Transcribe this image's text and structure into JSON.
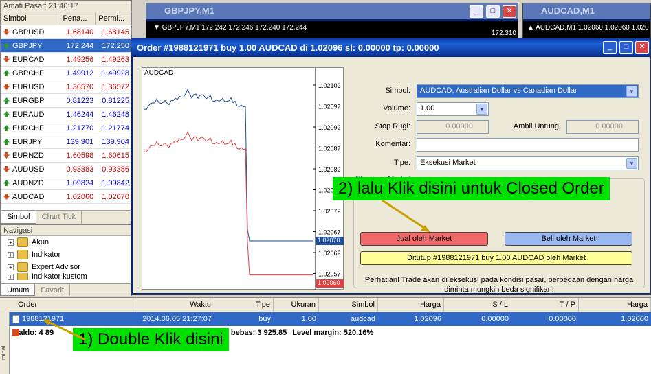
{
  "market_watch": {
    "title": "Amati Pasar: 21:40:17",
    "col_symbol": "Simbol",
    "col_bid": "Pena...",
    "col_ask": "Permi...",
    "rows": [
      {
        "symbol": "GBPUSD",
        "bid": "1.68140",
        "ask": "1.68145",
        "dir": "dn"
      },
      {
        "symbol": "GBPJPY",
        "bid": "172.244",
        "ask": "172.250",
        "dir": "up"
      },
      {
        "symbol": "EURCAD",
        "bid": "1.49256",
        "ask": "1.49263",
        "dir": "dn"
      },
      {
        "symbol": "GBPCHF",
        "bid": "1.49912",
        "ask": "1.49928",
        "dir": "up"
      },
      {
        "symbol": "EURUSD",
        "bid": "1.36570",
        "ask": "1.36572",
        "dir": "dn"
      },
      {
        "symbol": "EURGBP",
        "bid": "0.81223",
        "ask": "0.81225",
        "dir": "up"
      },
      {
        "symbol": "EURAUD",
        "bid": "1.46244",
        "ask": "1.46248",
        "dir": "up"
      },
      {
        "symbol": "EURCHF",
        "bid": "1.21770",
        "ask": "1.21774",
        "dir": "up"
      },
      {
        "symbol": "EURJPY",
        "bid": "139.901",
        "ask": "139.904",
        "dir": "up"
      },
      {
        "symbol": "EURNZD",
        "bid": "1.60598",
        "ask": "1.60615",
        "dir": "dn"
      },
      {
        "symbol": "AUDUSD",
        "bid": "0.93383",
        "ask": "0.93386",
        "dir": "dn"
      },
      {
        "symbol": "AUDNZD",
        "bid": "1.09824",
        "ask": "1.09842",
        "dir": "up"
      },
      {
        "symbol": "AUDCAD",
        "bid": "1.02060",
        "ask": "1.02070",
        "dir": "dn"
      }
    ],
    "tab_symbol": "Simbol",
    "tab_chart": "Chart Tick"
  },
  "navigator": {
    "title": "Navigasi",
    "items": [
      "Akun",
      "Indikator",
      "Expert Advisor",
      "Indikator kustom"
    ],
    "tab_common": "Umum",
    "tab_fav": "Favorit"
  },
  "chart_gbpjpy": {
    "title": "GBPJPY,M1",
    "info": "▼ GBPJPY,M1  172.242 172.246 172.240 172.244",
    "price": "172.310"
  },
  "chart_audcad": {
    "title": "AUDCAD,M1",
    "info": "▲ AUDCAD,M1  1.02060 1.02060 1.020"
  },
  "order": {
    "title": "Order #1988121971 buy 1.00 AUDCAD di 1.02096 sl: 0.00000 tp: 0.00000",
    "chart_label": "AUDCAD",
    "price_labels": [
      "1.02102",
      "1.02097",
      "1.02092",
      "1.02087",
      "1.02082",
      "1.02077",
      "1.02072",
      "1.02067",
      "1.02062",
      "1.02057"
    ],
    "ask_tag": "1.02070",
    "bid_tag": "1.02060",
    "symbol_label": "Simbol:",
    "symbol_value": "AUDCAD, Australian Dollar vs Canadian Dollar",
    "volume_label": "Volume:",
    "volume_value": "1.00",
    "sl_label": "Stop Rugi:",
    "sl_value": "0.00000",
    "tp_label": "Ambil Untung:",
    "tp_value": "0.00000",
    "comment_label": "Komentar:",
    "type_label": "Tipe:",
    "type_value": "Eksekusi Market",
    "group_label": "Eksekusi Market",
    "sell_button": "Jual oleh Market",
    "buy_button": "Beli oleh Market",
    "close_button": "Ditutup #1988121971 buy 1.00 AUDCAD oleh Market",
    "warning_1": "Perhatian! Trade akan di eksekusi pada kondisi pasar, perbedaan dengan harga",
    "warning_2": "diminta mungkin beda signifikan!"
  },
  "terminal": {
    "headers": [
      "Order",
      "Waktu",
      "Tipe",
      "Ukuran",
      "Simbol",
      "Harga",
      "S / L",
      "T / P",
      "Harga"
    ],
    "row": [
      "1988121971",
      "2014.06.05 21:27:07",
      "buy",
      "1.00",
      "audcad",
      "1.02096",
      "0.00000",
      "0.00000",
      "1.02060"
    ],
    "balance": "Saldo: 4 89",
    "free_margin": "n bebas: 3 925.85",
    "margin_level": "Level margin: 520.16%",
    "side_label": "minal"
  },
  "annotations": {
    "step1": "1) Double Klik disini",
    "step2": "2) lalu Klik disini untuk Closed Order"
  },
  "colors": {
    "sell": "#f06a6a",
    "buy": "#9ab8f0",
    "close": "#ffff99",
    "annotation": "#00e000",
    "sell_line": "#e04040",
    "buy_line": "#1f4e9a"
  }
}
